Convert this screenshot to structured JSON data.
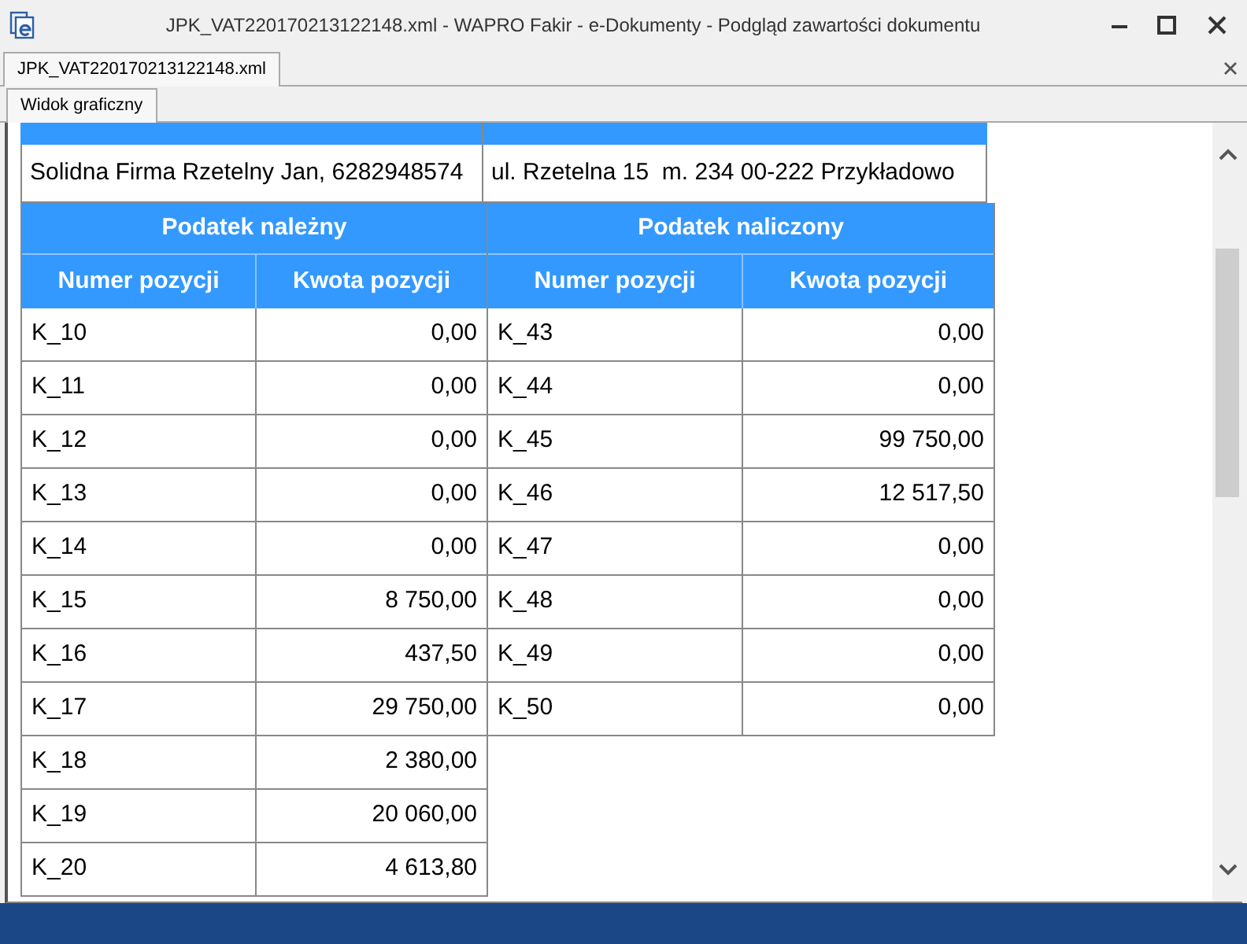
{
  "window": {
    "title": "JPK_VAT220170213122148.xml - WAPRO Fakir - e-Dokumenty - Podgląd zawartości dokumentu"
  },
  "document_tabs": [
    {
      "label": "JPK_VAT220170213122148.xml",
      "selected": true
    }
  ],
  "view_tabs": [
    {
      "label": "Widok graficzny",
      "selected": true
    }
  ],
  "header_row": {
    "name_nip": "Solidna Firma Rzetelny Jan, 6282948574",
    "address": "ul. Rzetelna 15  m. 234 00-222 Przykładowo"
  },
  "sections": [
    {
      "title": "Podatek należny",
      "columns": [
        "Numer pozycji",
        "Kwota pozycji"
      ],
      "rows": [
        [
          "K_10",
          "0,00"
        ],
        [
          "K_11",
          "0,00"
        ],
        [
          "K_12",
          "0,00"
        ],
        [
          "K_13",
          "0,00"
        ],
        [
          "K_14",
          "0,00"
        ],
        [
          "K_15",
          "8 750,00"
        ],
        [
          "K_16",
          "437,50"
        ],
        [
          "K_17",
          "29 750,00"
        ],
        [
          "K_18",
          "2 380,00"
        ],
        [
          "K_19",
          "20 060,00"
        ],
        [
          "K_20",
          "4 613,80"
        ]
      ]
    },
    {
      "title": "Podatek naliczony",
      "columns": [
        "Numer pozycji",
        "Kwota pozycji"
      ],
      "rows": [
        [
          "K_43",
          "0,00"
        ],
        [
          "K_44",
          "0,00"
        ],
        [
          "K_45",
          "99 750,00"
        ],
        [
          "K_46",
          "12 517,50"
        ],
        [
          "K_47",
          "0,00"
        ],
        [
          "K_48",
          "0,00"
        ],
        [
          "K_49",
          "0,00"
        ],
        [
          "K_50",
          "0,00"
        ]
      ]
    }
  ]
}
